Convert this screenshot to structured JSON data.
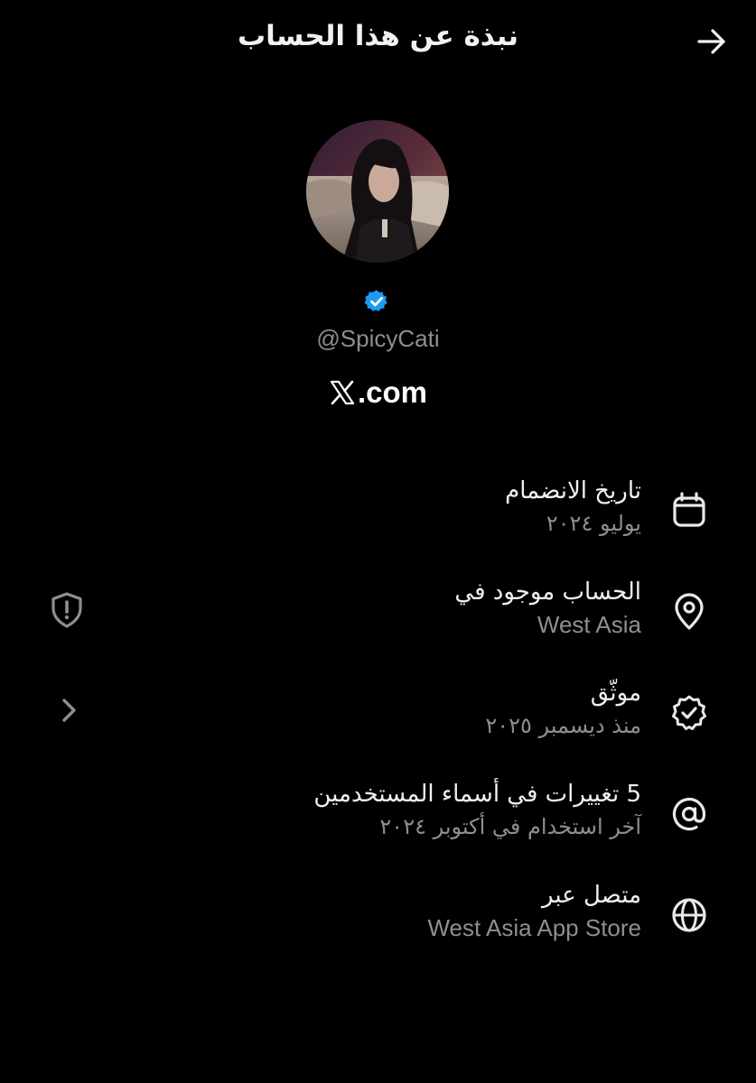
{
  "header": {
    "title": "نبذة عن هذا الحساب"
  },
  "icons": {
    "back": "arrow-right-icon",
    "calendar": "calendar-icon",
    "location": "location-pin-icon",
    "verified": "verified-badge-icon",
    "at": "at-sign-icon",
    "globe": "globe-icon",
    "shield": "shield-alert-icon",
    "chevron": "chevron-left-icon"
  },
  "colors": {
    "background": "#000000",
    "primary_text": "#e7e9ea",
    "secondary_text": "#8b8f93",
    "verified_blue": "#1d9bf0"
  },
  "profile": {
    "handle": "@SpicyCati",
    "source": ".com"
  },
  "rows": [
    {
      "title": "تاريخ الانضمام",
      "subtitle": "يوليو ٢٠٢٤"
    },
    {
      "title": "الحساب موجود في",
      "subtitle": "West Asia"
    },
    {
      "title": "موثّق",
      "subtitle": "منذ ديسمبر ٢٠٢٥"
    },
    {
      "title": "5 تغييرات في أسماء المستخدمين",
      "subtitle": "آخر استخدام في أكتوبر ٢٠٢٤"
    },
    {
      "title": "متصل عبر",
      "subtitle": "West Asia App Store"
    }
  ]
}
